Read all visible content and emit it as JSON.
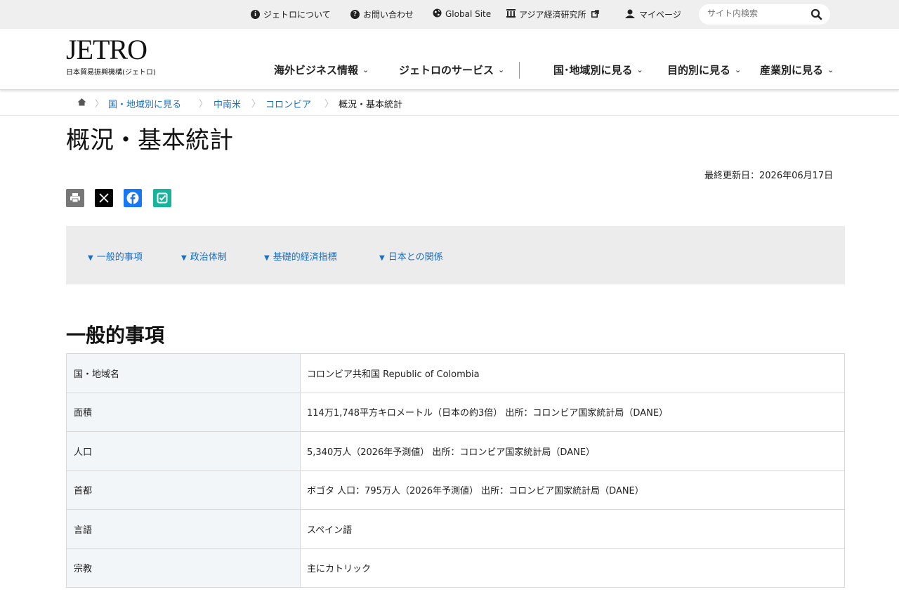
{
  "utility": {
    "about": "ジェトロについて",
    "contact": "お問い合わせ",
    "global": "Global Site",
    "ide": "アジア経済研究所",
    "mypage": "マイページ",
    "search_placeholder": "サイト内検索"
  },
  "logo": {
    "mark": "JETRO",
    "sub": "日本貿易振興機構(ジェトロ)"
  },
  "nav": [
    {
      "label": "海外ビジネス情報"
    },
    {
      "label": "ジェトロのサービス"
    },
    {
      "label": "国･地域別に見る"
    },
    {
      "label": "目的別に見る"
    },
    {
      "label": "産業別に見る"
    }
  ],
  "breadcrumb": [
    {
      "label": "国・地域別に見る"
    },
    {
      "label": "中南米"
    },
    {
      "label": "コロンビア"
    },
    {
      "label": "概況・基本統計"
    }
  ],
  "page": {
    "title": "概況・基本統計",
    "updated": "最終更新日：2026年06月17日"
  },
  "toc": [
    {
      "label": "一般的事項"
    },
    {
      "label": "政治体制"
    },
    {
      "label": "基礎的経済指標"
    },
    {
      "label": "日本との関係"
    }
  ],
  "section": {
    "title": "一般的事項",
    "rows": [
      {
        "label": "国・地域名",
        "value": "コロンビア共和国 Republic of Colombia"
      },
      {
        "label": "面積",
        "value": "114万1,748平方キロメートル（日本の約3倍） 出所：コロンビア国家統計局（DANE）"
      },
      {
        "label": "人口",
        "value": "5,340万人（2026年予測値） 出所：コロンビア国家統計局（DANE）"
      },
      {
        "label": "首都",
        "value": "ボゴタ 人口：795万人（2026年予測値） 出所：コロンビア国家統計局（DANE）"
      },
      {
        "label": "言語",
        "value": "スペイン語"
      },
      {
        "label": "宗教",
        "value": "主にカトリック"
      }
    ]
  },
  "icons": {
    "info": "info-icon",
    "help": "question-icon",
    "globe": "globe-icon",
    "building": "building-icon",
    "external": "external-link-icon",
    "user": "user-icon",
    "search": "search-icon",
    "home": "home-icon",
    "print": "print-icon",
    "x": "x-logo-icon",
    "facebook": "facebook-icon",
    "hatena": "bookmark-check-icon"
  },
  "colors": {
    "link": "#1a6fc2",
    "facebook": "#1877f2",
    "hatena": "#17b39b",
    "print": "#777777"
  }
}
